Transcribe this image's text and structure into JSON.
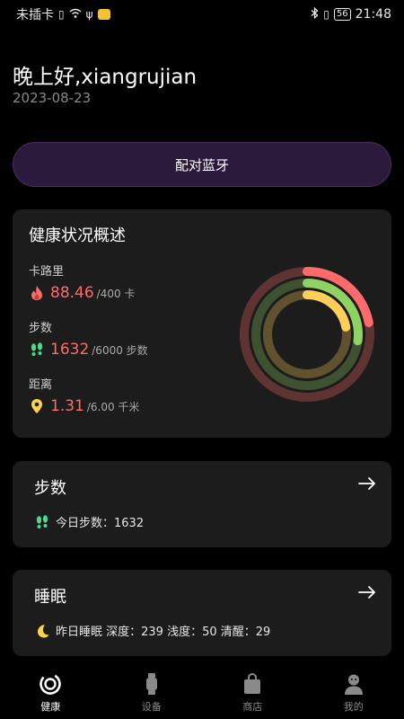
{
  "status_bar": {
    "carrier": "未插卡",
    "time": "21:48",
    "battery": "56"
  },
  "header": {
    "greeting": "晚上好,xiangrujian",
    "date": "2023-08-23"
  },
  "pair_button": {
    "label": "配对蓝牙"
  },
  "health": {
    "title": "健康状况概述",
    "calories": {
      "label": "卡路里",
      "value": "88.46",
      "goal": "/400 卡",
      "icon": "flame-icon",
      "color": "#ff6b6b"
    },
    "steps": {
      "label": "步数",
      "value": "1632",
      "goal": "/6000 步数",
      "icon": "footprints-icon",
      "color": "#4cd98a"
    },
    "distance": {
      "label": "距离",
      "value": "1.31",
      "goal": "/6.00 千米",
      "icon": "location-pin-icon",
      "color": "#ffd24a"
    },
    "ring_colors": {
      "calories": "#ff6b6b",
      "steps": "#8fd163",
      "distance": "#ffcf5a"
    },
    "progress": {
      "calories": 0.22,
      "steps": 0.27,
      "distance": 0.22
    }
  },
  "steps_card": {
    "title": "步数",
    "line": "今日步数：1632"
  },
  "sleep_card": {
    "title": "睡眠",
    "line": "昨日睡眠 深度：239 浅度：50 清醒：29"
  },
  "nav": {
    "items": [
      {
        "label": "健康",
        "icon": "health-ring-icon",
        "active": true
      },
      {
        "label": "设备",
        "icon": "watch-icon",
        "active": false
      },
      {
        "label": "商店",
        "icon": "shopping-bag-icon",
        "active": false
      },
      {
        "label": "我的",
        "icon": "profile-icon",
        "active": false
      }
    ]
  }
}
